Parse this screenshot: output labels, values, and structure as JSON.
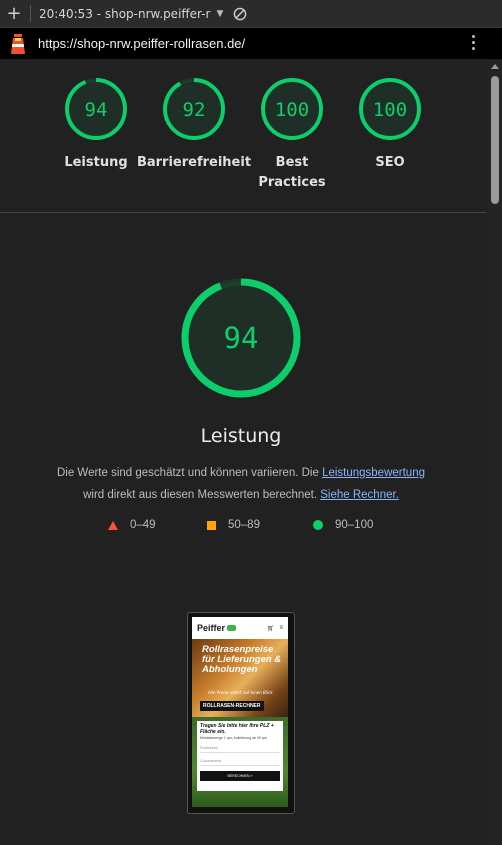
{
  "toolbar": {
    "new_label": "+",
    "session": "20:40:53 - shop-nrw.peiffer-r"
  },
  "urlbar": {
    "url": "https://shop-nrw.peiffer-rollrasen.de/"
  },
  "scores": [
    {
      "value": "94",
      "label": "Leistung",
      "fraction": 0.94
    },
    {
      "value": "92",
      "label": "Barrierefreiheit",
      "fraction": 0.92
    },
    {
      "value": "100",
      "label": "Best Practices",
      "fraction": 1.0
    },
    {
      "value": "100",
      "label": "SEO",
      "fraction": 1.0
    }
  ],
  "performance": {
    "score": "94",
    "fraction": 0.94,
    "title": "Leistung",
    "desc_part1": "Die Werte sind geschätzt und können variieren. Die ",
    "link1": "Leistungsbewertung",
    "desc_part2": "wird direkt aus diesen Messwerten berechnet.",
    "link2": "Siehe Rechner."
  },
  "legend": {
    "fail": "0–49",
    "average": "50–89",
    "pass": "90–100"
  },
  "colors": {
    "pass": "#0cce6b",
    "average": "#ffa400",
    "fail": "#ff4e42",
    "link": "#8ab4f8"
  },
  "screenshot": {
    "logo": "Peiffer",
    "hero_title": "Rollrasenpreise für Lieferungen & Abholungen",
    "hero_sub": "Alle Preise sofort auf einen Blick",
    "badge": "ROLLRASEN-RECHNER",
    "card_title": "Tragen Sie bitte hier Ihre PLZ + Fläche ein.",
    "card_note": "Mindestmenge 1 qm, Anlieferung ab 99 qm.",
    "field1": "Postleitzahl",
    "field2": "Quadratmeter",
    "button": "BERECHNEN »"
  }
}
